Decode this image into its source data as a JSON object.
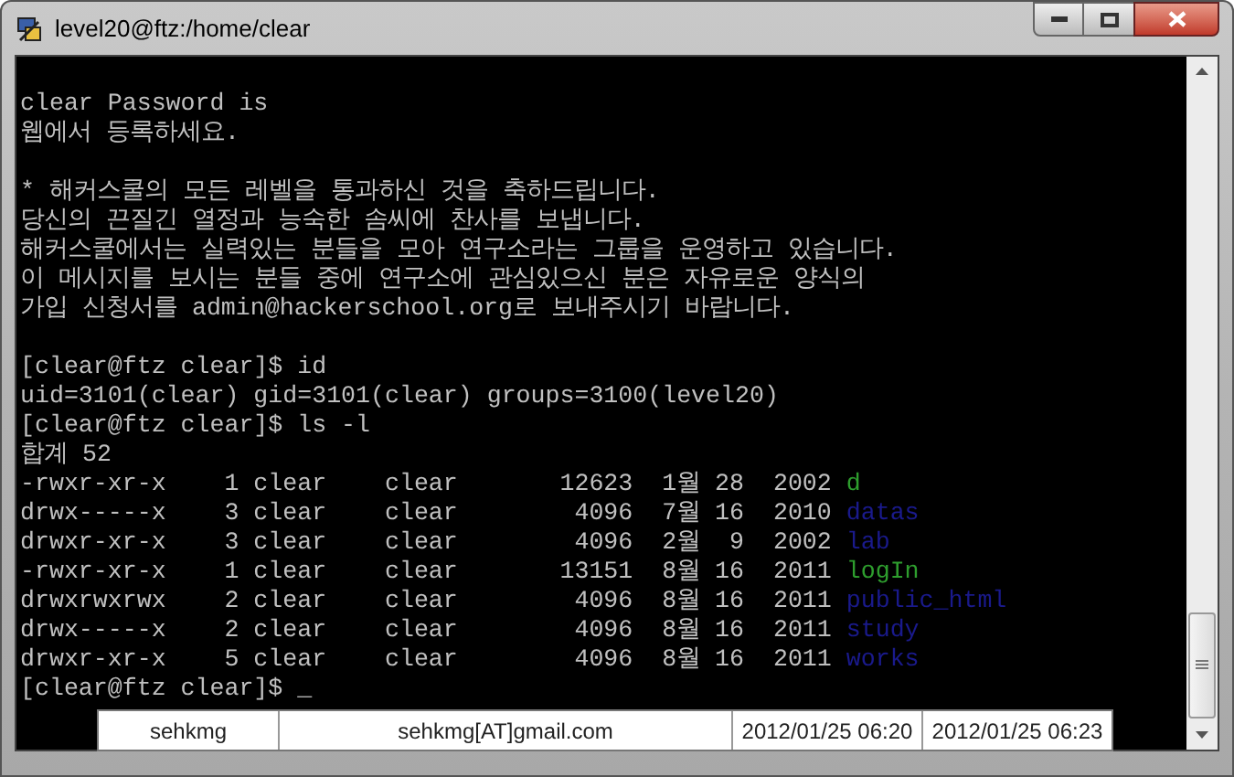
{
  "window": {
    "title": "level20@ftz:/home/clear"
  },
  "terminal": {
    "lines": [
      {
        "kind": "blank"
      },
      {
        "kind": "text",
        "text": "clear Password is"
      },
      {
        "kind": "text",
        "text": "웹에서 등록하세요."
      },
      {
        "kind": "blank"
      },
      {
        "kind": "text",
        "text": "* 해커스쿨의 모든 레벨을 통과하신 것을 축하드립니다."
      },
      {
        "kind": "text",
        "text": "당신의 끈질긴 열정과 능숙한 솜씨에 찬사를 보냅니다."
      },
      {
        "kind": "text",
        "text": "해커스쿨에서는 실력있는 분들을 모아 연구소라는 그룹을 운영하고 있습니다."
      },
      {
        "kind": "text",
        "text": "이 메시지를 보시는 분들 중에 연구소에 관심있으신 분은 자유로운 양식의"
      },
      {
        "kind": "text",
        "text": "가입 신청서를 admin@hackerschool.org로 보내주시기 바랍니다."
      },
      {
        "kind": "blank"
      },
      {
        "kind": "text",
        "text": "[clear@ftz clear]$ id"
      },
      {
        "kind": "text",
        "text": "uid=3101(clear) gid=3101(clear) groups=3100(level20)"
      },
      {
        "kind": "text",
        "text": "[clear@ftz clear]$ ls -l"
      },
      {
        "kind": "text",
        "text": "합계 52"
      },
      {
        "kind": "file",
        "text": "-rwxr-xr-x    1 clear    clear       12623  1월 28  2002 ",
        "name": "d",
        "color": "#2e9e2e"
      },
      {
        "kind": "file",
        "text": "drwx-----x    3 clear    clear        4096  7월 16  2010 ",
        "name": "datas",
        "color": "#1a1a8c"
      },
      {
        "kind": "file",
        "text": "drwxr-xr-x    3 clear    clear        4096  2월  9  2002 ",
        "name": "lab",
        "color": "#1a1a8c"
      },
      {
        "kind": "file",
        "text": "-rwxr-xr-x    1 clear    clear       13151  8월 16  2011 ",
        "name": "logIn",
        "color": "#2e9e2e"
      },
      {
        "kind": "file",
        "text": "drwxrwxrwx    2 clear    clear        4096  8월 16  2011 ",
        "name": "public_html",
        "color": "#1a1a8c"
      },
      {
        "kind": "file",
        "text": "drwx-----x    2 clear    clear        4096  8월 16  2011 ",
        "name": "study",
        "color": "#1a1a8c"
      },
      {
        "kind": "file",
        "text": "drwxr-xr-x    5 clear    clear        4096  8월 16  2011 ",
        "name": "works",
        "color": "#1a1a8c"
      },
      {
        "kind": "prompt",
        "text": "[clear@ftz clear]$ ",
        "cursor": "_"
      }
    ]
  },
  "info_bar": [
    "sehkmg",
    "sehkmg[AT]gmail.com",
    "2012/01/25 06:20",
    "2012/01/25 06:23"
  ]
}
